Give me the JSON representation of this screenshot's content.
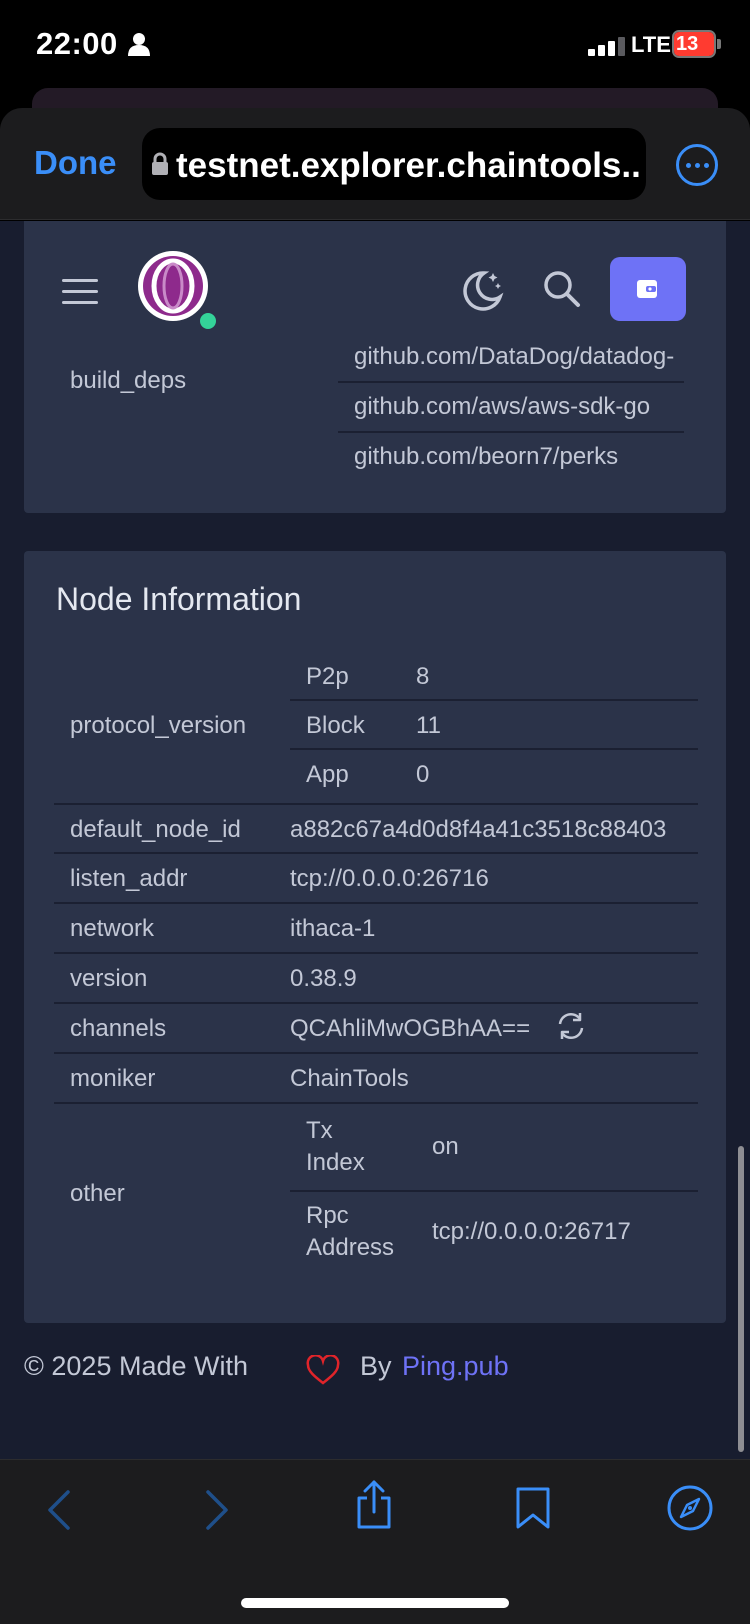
{
  "status_bar": {
    "time": "22:00",
    "network": "LTE",
    "battery": "13"
  },
  "browser": {
    "done_label": "Done",
    "url": "testnet.explorer.chaintools...."
  },
  "build_deps": {
    "key": "build_deps",
    "values": [
      "github.com/DataDog/datadog-",
      "github.com/aws/aws-sdk-go",
      "github.com/beorn7/perks"
    ]
  },
  "node_info": {
    "title": "Node Information",
    "protocol_version": {
      "key": "protocol_version",
      "rows": [
        {
          "label": "P2p",
          "value": "8"
        },
        {
          "label": "Block",
          "value": "11"
        },
        {
          "label": "App",
          "value": "0"
        }
      ]
    },
    "rows": [
      {
        "key": "default_node_id",
        "value": "a882c67a4d0d8f4a41c3518c88403"
      },
      {
        "key": "listen_addr",
        "value": "tcp://0.0.0.0:26716"
      },
      {
        "key": "network",
        "value": "ithaca-1"
      },
      {
        "key": "version",
        "value": "0.38.9"
      },
      {
        "key": "channels",
        "value": "QCAhliMwOGBhAA=="
      },
      {
        "key": "moniker",
        "value": "ChainTools"
      }
    ],
    "other": {
      "key": "other",
      "rows": [
        {
          "label_line1": "Tx",
          "label_line2": "Index",
          "value": "on"
        },
        {
          "label_line1": "Rpc",
          "label_line2": "Address",
          "value": "tcp://0.0.0.0:26717"
        }
      ]
    }
  },
  "footer": {
    "copyright": "©  2025  Made With",
    "by": "By",
    "link": "Ping.pub"
  },
  "colors": {
    "accent": "#6e72f6",
    "ios_blue": "#3a8ef8",
    "card": "#2b3349",
    "page": "#181d2f",
    "online": "#34d399",
    "heart": "#e0242a"
  }
}
